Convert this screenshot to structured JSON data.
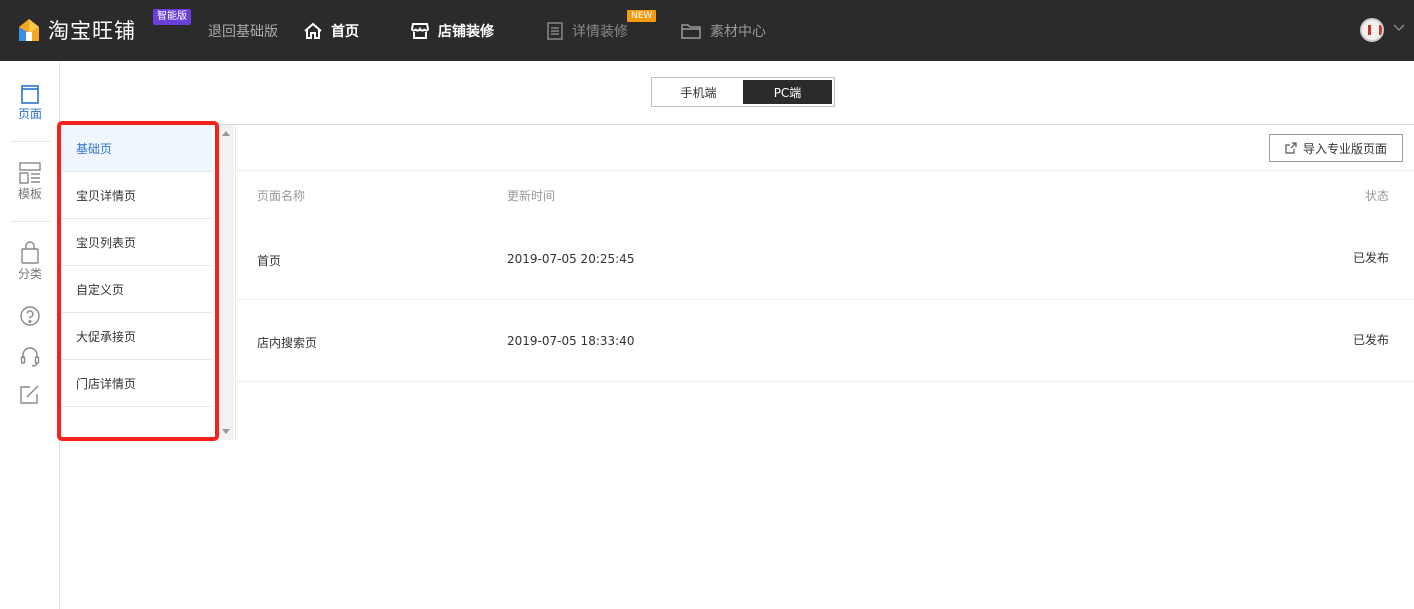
{
  "topbar": {
    "logo_text": "淘宝旺铺",
    "logo_badge": "智能版",
    "nav": {
      "back_label": "退回基础版",
      "home_label": "首页",
      "shop_decor_label": "店铺装修",
      "detail_decor_label": "详情装修",
      "detail_badge": "NEW",
      "material_label": "素材中心"
    }
  },
  "rail": {
    "page_label": "页面",
    "template_label": "模板",
    "category_label": "分类"
  },
  "device_toggle": {
    "mobile_label": "手机端",
    "pc_label": "PC端"
  },
  "page_types": [
    {
      "label": "基础页"
    },
    {
      "label": "宝贝详情页"
    },
    {
      "label": "宝贝列表页"
    },
    {
      "label": "自定义页"
    },
    {
      "label": "大促承接页"
    },
    {
      "label": "门店详情页"
    }
  ],
  "import_button_label": "导入专业版页面",
  "table": {
    "headers": {
      "name": "页面名称",
      "updated": "更新时间",
      "status": "状态"
    },
    "rows": [
      {
        "name": "首页",
        "updated": "2019-07-05 20:25:45",
        "status": "已发布"
      },
      {
        "name": "店内搜索页",
        "updated": "2019-07-05 18:33:40",
        "status": "已发布"
      }
    ]
  },
  "colors": {
    "topbar_bg": "#2b2b2b",
    "accent_blue": "#2c73d2",
    "highlight_red": "#f5231a",
    "badge_purple": "#6a3fd8",
    "badge_orange": "#f39a11"
  }
}
